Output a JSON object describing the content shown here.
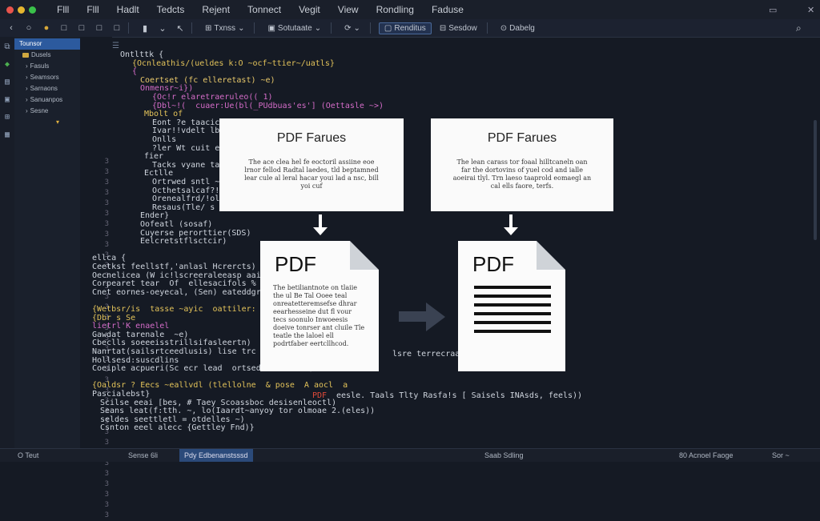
{
  "menubar": {
    "items": [
      "Flll",
      "Flll",
      "Hadlt",
      "Tedcts",
      "Rejent",
      "Tonnect",
      "Vegit",
      "View",
      "Rondling",
      "Faduse"
    ],
    "window_controls": [
      "▭",
      "✕"
    ]
  },
  "toolbar": {
    "nav_icons": [
      "‹",
      "○",
      "●",
      "□",
      "□",
      "□",
      "□"
    ],
    "buttons": [
      "Txnss",
      "Sotutaate",
      "Renditus",
      "Sesdow",
      "Dabelg"
    ],
    "search_icon": "⌕"
  },
  "sidebar": {
    "items": [
      "Tounsor",
      "Dusels",
      "Fasuls",
      "Seamsors",
      "Sarnaons",
      "Sanuanpos",
      "Sesne"
    ]
  },
  "gutter": {
    "numbers": [
      "3",
      "3",
      "3",
      "3",
      "3",
      "3",
      "3",
      "3",
      "3",
      "3",
      "3",
      "3",
      "3",
      "3",
      "3",
      "3",
      "3",
      "3",
      "3",
      "3",
      "3",
      "3",
      "3",
      "3",
      "3",
      "3",
      "3",
      "3",
      "3",
      "3",
      "3",
      "3",
      "3",
      "3",
      "3"
    ]
  },
  "code": {
    "lines": [
      {
        "text": "Ontlttk {",
        "indent": 40,
        "color": "#cfd5de"
      },
      {
        "text": "{Ocnleathis/(ueldes k:O ~ocf~ttier~/uatls}",
        "indent": 55,
        "color": "#e3c35a"
      },
      {
        "text": "{",
        "indent": 55,
        "color": "#d46cc8"
      },
      {
        "text": "Coertset (fc elleretast) ~e)",
        "indent": 65,
        "color": "#e8c86a"
      },
      {
        "text": "Onmensr~i})",
        "indent": 65,
        "color": "#d46cc8"
      },
      {
        "text": "{Oc!r elaretraeruleo(( 1)",
        "indent": 80,
        "color": "#d46cc8"
      },
      {
        "text": "{Dbl~!(  cuaer:Ue(bl(_PUdbuas'es'] (Oettasle ~>)",
        "indent": 80,
        "color": "#d46cc8"
      },
      {
        "text": "Mbolt of",
        "indent": 70,
        "color": "#e3c35a"
      },
      {
        "text": "Eont ?e taacic",
        "indent": 80,
        "color": "#cfd5de"
      },
      {
        "text": "Ivar!!vdelt lbe",
        "indent": 80,
        "color": "#cfd5de"
      },
      {
        "text": "Onlls",
        "indent": 80,
        "color": "#cfd5de"
      },
      {
        "text": "?ler Wt cuit ean",
        "indent": 80,
        "color": "#cfd5de"
      },
      {
        "text": "fier",
        "indent": 70,
        "color": "#cfd5de"
      },
      {
        "text": "Tacks vyane tarr",
        "indent": 80,
        "color": "#cfd5de"
      },
      {
        "text": "Ectlle",
        "indent": 70,
        "color": "#cfd5de"
      },
      {
        "text": "Ortrwed sntl ~e",
        "indent": 80,
        "color": "#cfd5de"
      },
      {
        "text": "Octhetsalcaf?! ~",
        "indent": 80,
        "color": "#cfd5de"
      },
      {
        "text": "Orenealfrd/!olsl.",
        "indent": 80,
        "color": "#cfd5de"
      },
      {
        "text": "Resaus(Tle/ s lrs1)",
        "indent": 80,
        "color": "#cfd5de"
      },
      {
        "text": "Ender}",
        "indent": 65,
        "color": "#cfd5de"
      },
      {
        "text": "Oofeatl (sosaf)",
        "indent": 65,
        "color": "#cfd5de"
      },
      {
        "text": "Cuyerse perorttier(SDS)",
        "indent": 65,
        "color": "#cfd5de"
      },
      {
        "text": "Eelcretstflsctcir)",
        "indent": 65,
        "color": "#cfd5de"
      },
      {
        "text": "",
        "indent": 0,
        "color": "#cfd5de"
      },
      {
        "text": "ellca {",
        "indent": 5,
        "color": "#cfd5de"
      },
      {
        "text": "Ceetkst feellstf,'anlasl Hcrercts)",
        "indent": 5,
        "color": "#cfd5de"
      },
      {
        "text": "Oecnelicea (W ic!lscreeraleeasp aai",
        "indent": 5,
        "color": "#cfd5de"
      },
      {
        "text": "Corpearet tear  Of  ellesacifols % ;",
        "indent": 5,
        "color": "#cfd5de"
      },
      {
        "text": "Cnet eornes-oeyecal, (Sen) eateddgr eplsc",
        "indent": 5,
        "color": "#cfd5de"
      },
      {
        "text": "",
        "indent": 0,
        "color": "#cfd5de"
      },
      {
        "text": "{Wetbsr/is  tasse ~ayic  oattiler: leel(c",
        "indent": 5,
        "color": "#e3c35a"
      },
      {
        "text": "{Dbr s Se",
        "indent": 5,
        "color": "#e3c35a"
      },
      {
        "text": "lietrl'K enaelel",
        "indent": 5,
        "color": "#d46cc8"
      },
      {
        "text": "Gawdat tarenale  ~e)",
        "indent": 5,
        "color": "#cfd5de"
      },
      {
        "text": "Cbeclls soeeeisstrillsifasleertn)",
        "indent": 5,
        "color": "#cfd5de"
      },
      {
        "text": "Nanrtat(sailsrtceedlusis) lise trc ls (le",
        "indent": 5,
        "color": "#cfd5de"
      },
      {
        "text": "Hollsesd:suscdlins",
        "indent": 5,
        "color": "#cfd5de"
      },
      {
        "text": "Coeiple acpueri(Sc ecr lead  ortsedal ferstli)",
        "indent": 5,
        "color": "#cfd5de"
      },
      {
        "text": "",
        "indent": 0,
        "color": "#cfd5de"
      },
      {
        "text": "{Oaldsr ? Eecs ~eallvdl (tlellolne  & pose  A aocl  a",
        "indent": 5,
        "color": "#e3c35a"
      },
      {
        "text": "Pascialebst}",
        "indent": 5,
        "color": "#cfd5de"
      },
      {
        "text": "Scilse eeai [bes, # Taey Scoassboc desisenleoctl)",
        "indent": 15,
        "color": "#cfd5de"
      },
      {
        "text": "Seans leat(f:tth. ~, lo(Iaardt~anyoy tor olmoae 2.(eles))",
        "indent": 15,
        "color": "#cfd5de"
      },
      {
        "text": "seldes seettletl = otdelles ~)",
        "indent": 15,
        "color": "#cfd5de"
      },
      {
        "text": "Csnton eeel alecc {Gettley Fnd)}",
        "indent": 15,
        "color": "#cfd5de"
      }
    ],
    "inline_tokens": {
      "pdf_word": "PDF",
      "tail_text": "eesle. Taals Tlty Rasfa!s [ Saisels INAsds, feels))",
      "tail_right_1": "lsre terrecraals"
    }
  },
  "card1": {
    "title": "PDF Farues",
    "text": "The ace clea hel fe eoctoril assiine eoe lrnor fellod Radtal laedes, tld beptamned lear cule al leral hacar youi lad a nsc, bill yoi cuf"
  },
  "card2": {
    "title": "PDF Farues",
    "text": "The lean carass tor foaal hilltcaneln oan far the dortovins of yuel cod and ialle aoeirai tlyl. Trn laeso taaprold eomaegl an cal ells faore, terfs."
  },
  "doc1": {
    "label": "PDF",
    "text": "The betiliantnote on tlaiie the ul Be Tal Ooee teal onreatetteremsefse dhrar eearhesseine dut fl  vour tecs soonulo Inwoeesis doeive tonrser ant cluile Tle teatle the laloel ell podrtfaber eertcllhcod."
  },
  "doc2": {
    "label": "PDF"
  },
  "statusbar": {
    "left": "O  Teut",
    "mid1": "Sense 6li",
    "mid2": "Pdy Edbenanstsssd",
    "right1": "Saab Sdling",
    "right2": "80 Acnoel  Faoge",
    "right3": "Sor ~"
  },
  "colors": {
    "accent": "#2c5a9e",
    "pdf_red": "#e04a3a",
    "keyword_yellow": "#e3c35a",
    "keyword_pink": "#d46cc8"
  }
}
